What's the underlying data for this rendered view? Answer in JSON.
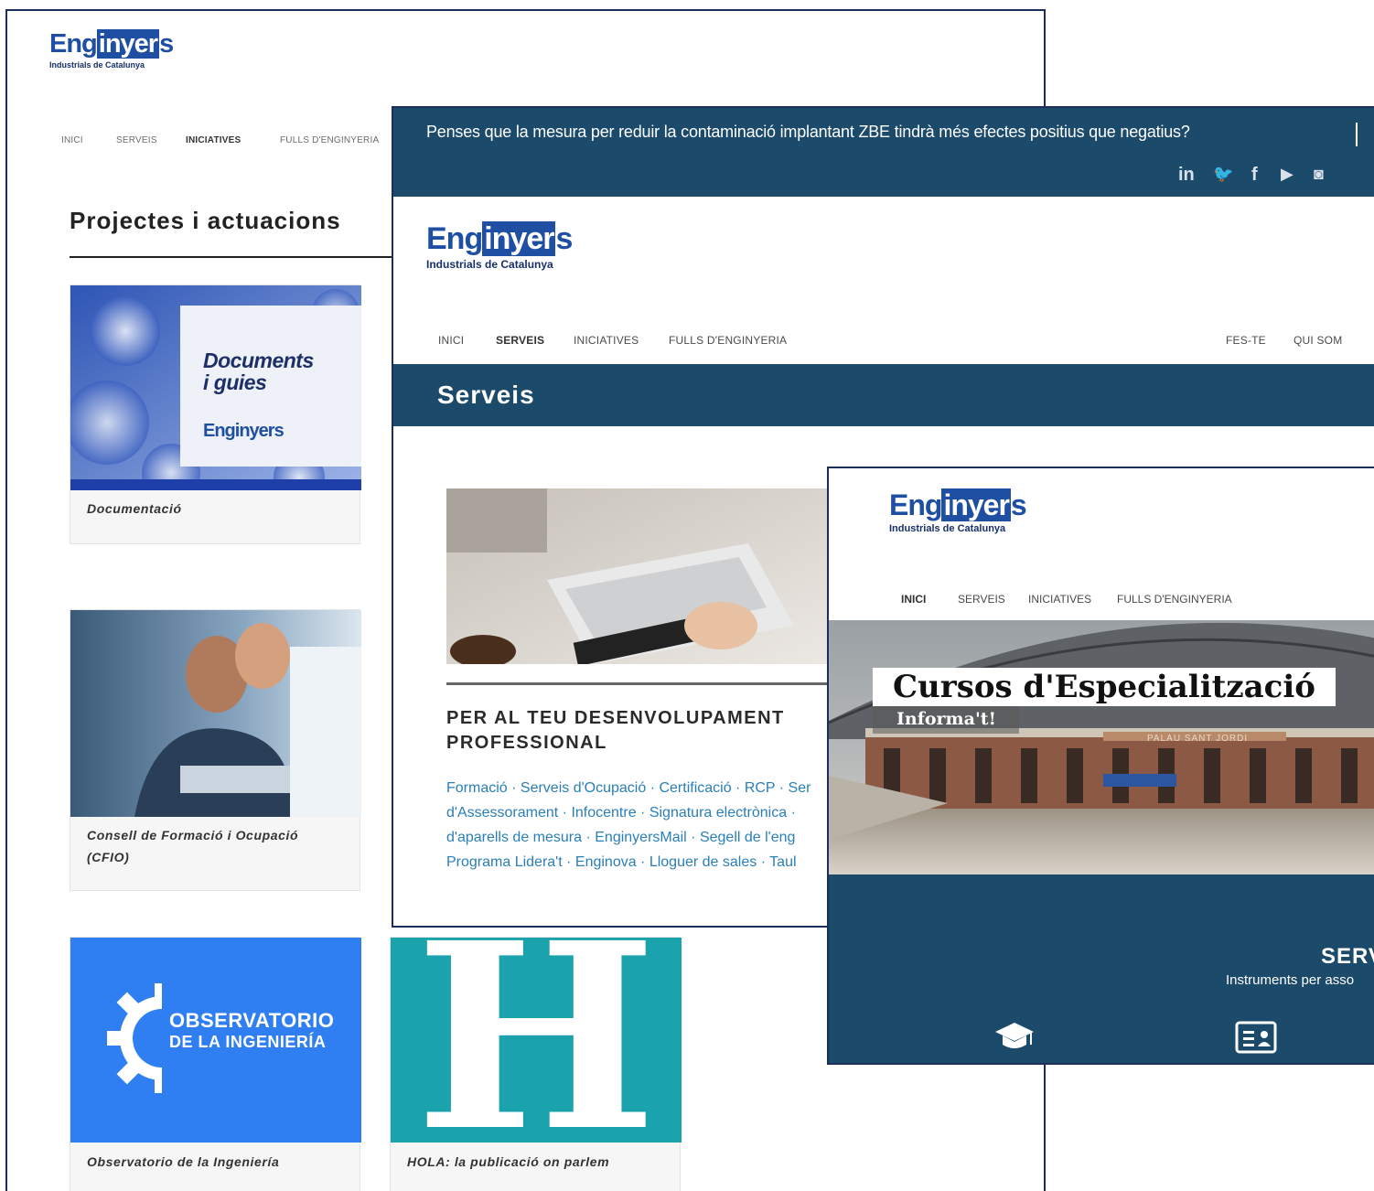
{
  "panel1": {
    "logo": {
      "word_pre": "Eng",
      "word_box": "inyer",
      "word_post": "s",
      "subtitle": "Industrials de Catalunya"
    },
    "nav": [
      "INICI",
      "SERVEIS",
      "INICIATIVES",
      "FULLS D'ENGINYERIA"
    ],
    "heading": "Projectes i actuacions",
    "cards": [
      {
        "caption": "Documentació",
        "image_title_1": "Documents",
        "image_title_2": "i guies",
        "image_logo": "Enginyers"
      },
      {
        "caption_1": "Consell de Formació i Ocupació",
        "caption_2": "(CFIO)"
      },
      {
        "caption_1": "Observatorio de la Ingeniería",
        "image_line_1": "OBSERVATORIO",
        "image_line_2": "DE LA INGENIERÍA"
      },
      {
        "caption_1": "HOLA: la publicació on parlem",
        "image_letter": "H"
      }
    ]
  },
  "panel2": {
    "poll_question": "Penses que la mesura per reduir la contaminació implantant ZBE tindrà més efectes positius que negatius?",
    "social": [
      "in",
      "🐦",
      "f",
      "▶",
      "◙"
    ],
    "social_icons": [
      "linkedin-icon",
      "twitter-icon",
      "facebook-icon",
      "youtube-icon",
      "instagram-icon"
    ],
    "logo": {
      "word_pre": "Eng",
      "word_box": "inyer",
      "word_post": "s",
      "subtitle": "Industrials de Catalunya"
    },
    "nav_left": [
      "INICI",
      "SERVEIS",
      "INICIATIVES",
      "FULLS D'ENGINYERIA"
    ],
    "nav_right": [
      "FES-TE",
      "QUI SOM"
    ],
    "section_title": "Serveis",
    "feature_title_1": "PER AL TEU DESENVOLUPAMENT",
    "feature_title_2": "PROFESSIONAL",
    "links_line_1": "Formació · Serveis d'Ocupació · Certificació · RCP · Ser",
    "links_line_2": "d'Assessorament · Infocentre · Signatura electrònica ·",
    "links_line_3": "d'aparells de mesura  · EnginyersMail · Segell de l'eng",
    "links_line_4": "Programa Lidera't · Enginova · Lloguer de sales  · Taul"
  },
  "panel3": {
    "logo": {
      "word_pre": "Eng",
      "word_box": "inyer",
      "word_post": "s",
      "subtitle": "Industrials de Catalunya"
    },
    "nav": [
      "INICI",
      "SERVEIS",
      "INICIATIVES",
      "FULLS D'ENGINYERIA"
    ],
    "hero_title": "Cursos d'Especialització",
    "hero_cta": "Informa't!",
    "building_sign": "PALAU SANT JORDI",
    "section_title": "SERV",
    "section_sub": "Instruments per asso",
    "icons": [
      "graduation-cap-icon",
      "id-card-icon"
    ]
  }
}
